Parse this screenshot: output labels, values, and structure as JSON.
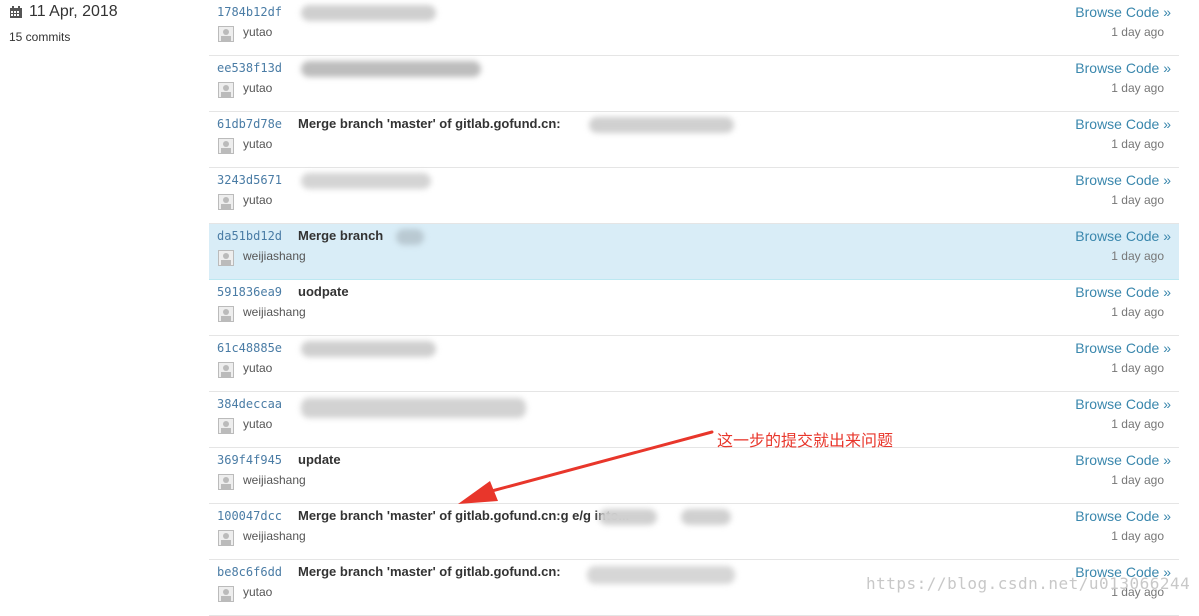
{
  "day": {
    "date": "11 Apr, 2018",
    "commit_count": "15 commits"
  },
  "commits": [
    {
      "sha": "1784b12df",
      "title": "",
      "author": "yutao",
      "browse": "Browse Code »",
      "ago": "1 day ago"
    },
    {
      "sha": "ee538f13d",
      "title": "",
      "author": "yutao",
      "browse": "Browse Code »",
      "ago": "1 day ago"
    },
    {
      "sha": "61db7d78e",
      "title": "Merge branch 'master' of gitlab.gofund.cn:",
      "author": "yutao",
      "browse": "Browse Code »",
      "ago": "1 day ago"
    },
    {
      "sha": "3243d5671",
      "title": "",
      "author": "yutao",
      "browse": "Browse Code »",
      "ago": "1 day ago"
    },
    {
      "sha": "da51bd12d",
      "title": "Merge branch",
      "author": "weijiashang",
      "browse": "Browse Code »",
      "ago": "1 day ago"
    },
    {
      "sha": "591836ea9",
      "title": "uodpate",
      "author": "weijiashang",
      "browse": "Browse Code »",
      "ago": "1 day ago"
    },
    {
      "sha": "61c48885e",
      "title": "",
      "author": "yutao",
      "browse": "Browse Code »",
      "ago": "1 day ago"
    },
    {
      "sha": "384deccaa",
      "title": "",
      "author": "yutao",
      "browse": "Browse Code »",
      "ago": "1 day ago"
    },
    {
      "sha": "369f4f945",
      "title": "update",
      "author": "weijiashang",
      "browse": "Browse Code »",
      "ago": "1 day ago"
    },
    {
      "sha": "100047dcc",
      "title": "Merge branch 'master' of gitlab.gofund.cn:g                e/g              into...",
      "author": "weijiashang",
      "browse": "Browse Code »",
      "ago": "1 day ago"
    },
    {
      "sha": "be8c6f6dd",
      "title": "Merge branch 'master' of gitlab.gofund.cn:",
      "author": "yutao",
      "browse": "Browse Code »",
      "ago": "1 day ago"
    }
  ],
  "annotation": "这一步的提交就出来问题",
  "watermark": "https://blog.csdn.net/u013066244",
  "colors": {
    "link": "#3a87ad",
    "sha": "#4a7ca5",
    "highlight_row": "#d9edf7",
    "annotation": "#e8362b"
  }
}
